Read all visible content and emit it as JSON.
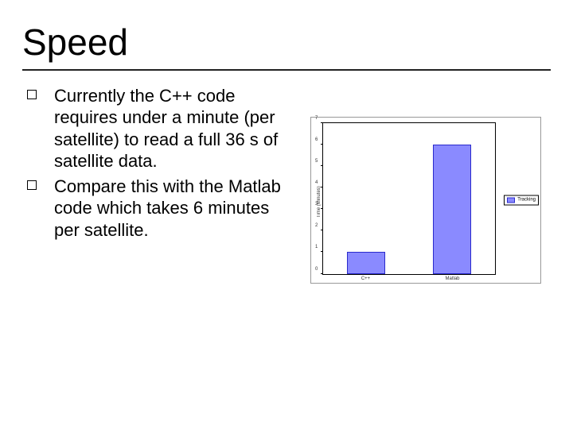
{
  "title": "Speed",
  "bullets": [
    "Currently the C++ code requires under a minute (per satellite) to read a full 36 s of satellite data.",
    "Compare this with the Matlab code which takes 6 minutes per satellite."
  ],
  "chart_data": {
    "type": "bar",
    "categories": [
      "C++",
      "Matlab"
    ],
    "values": [
      1,
      6
    ],
    "title": "",
    "xlabel": "",
    "ylabel": "Time (Minutes)",
    "ylim": [
      0,
      7
    ],
    "yticks": [
      0,
      1,
      2,
      3,
      4,
      5,
      6,
      7
    ],
    "series": [
      {
        "name": "Tracking",
        "values": [
          1,
          6
        ]
      }
    ],
    "legend_position": "right",
    "bar_color": "#8a8aff"
  }
}
